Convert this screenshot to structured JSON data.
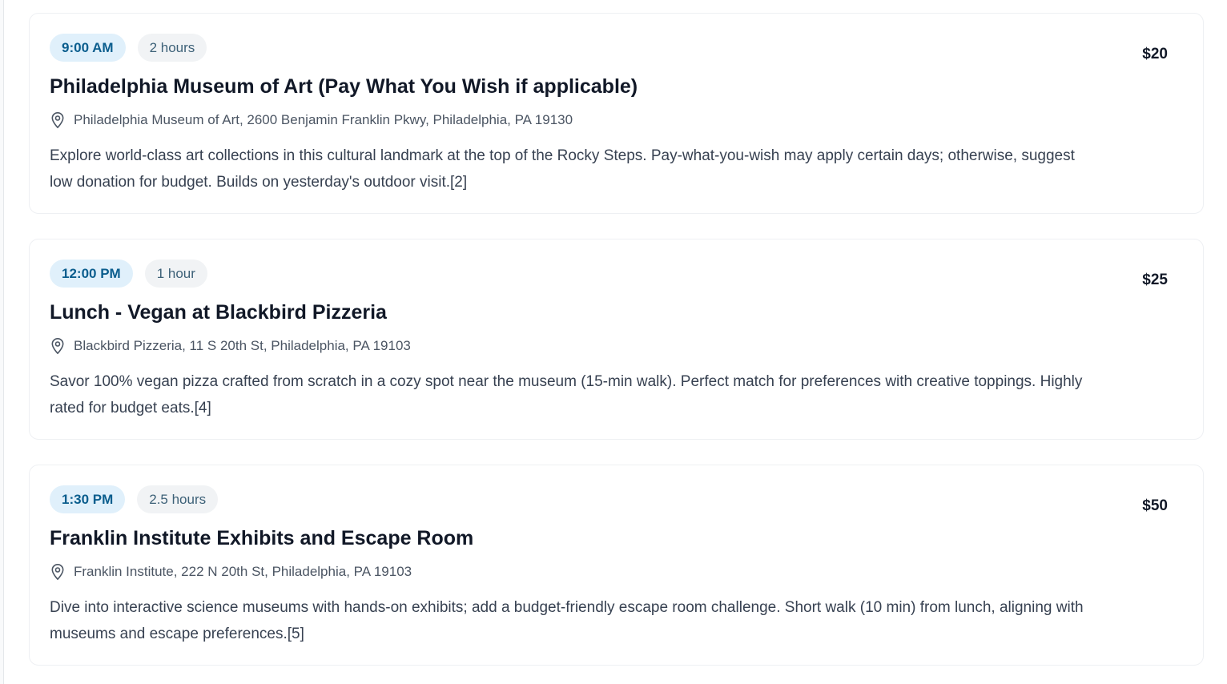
{
  "itinerary": {
    "items": [
      {
        "time": "9:00 AM",
        "duration": "2 hours",
        "title": "Philadelphia Museum of Art (Pay What You Wish if applicable)",
        "location": "Philadelphia Museum of Art, 2600 Benjamin Franklin Pkwy, Philadelphia, PA 19130",
        "description": "Explore world-class art collections in this cultural landmark at the top of the Rocky Steps. Pay-what-you-wish may apply certain days; otherwise, suggest low donation for budget. Builds on yesterday's outdoor visit.[2]",
        "price": "$20",
        "location_icon": "map-pin-icon"
      },
      {
        "time": "12:00 PM",
        "duration": "1 hour",
        "title": "Lunch - Vegan at Blackbird Pizzeria",
        "location": "Blackbird Pizzeria, 11 S 20th St, Philadelphia, PA 19103",
        "description": "Savor 100% vegan pizza crafted from scratch in a cozy spot near the museum (15-min walk). Perfect match for preferences with creative toppings. Highly rated for budget eats.[4]",
        "price": "$25",
        "location_icon": "map-pin-icon"
      },
      {
        "time": "1:30 PM",
        "duration": "2.5 hours",
        "title": "Franklin Institute Exhibits and Escape Room",
        "location": "Franklin Institute, 222 N 20th St, Philadelphia, PA 19103",
        "description": "Dive into interactive science museums with hands-on exhibits; add a budget-friendly escape room challenge. Short walk (10 min) from lunch, aligning with museums and escape preferences.[5]",
        "price": "$50",
        "location_icon": "map-pin-icon"
      }
    ]
  },
  "colors": {
    "time_badge_bg": "#e0f0fb",
    "time_badge_text": "#0b5e8e",
    "duration_badge_bg": "#f1f3f5",
    "card_border": "#eef0f3"
  }
}
